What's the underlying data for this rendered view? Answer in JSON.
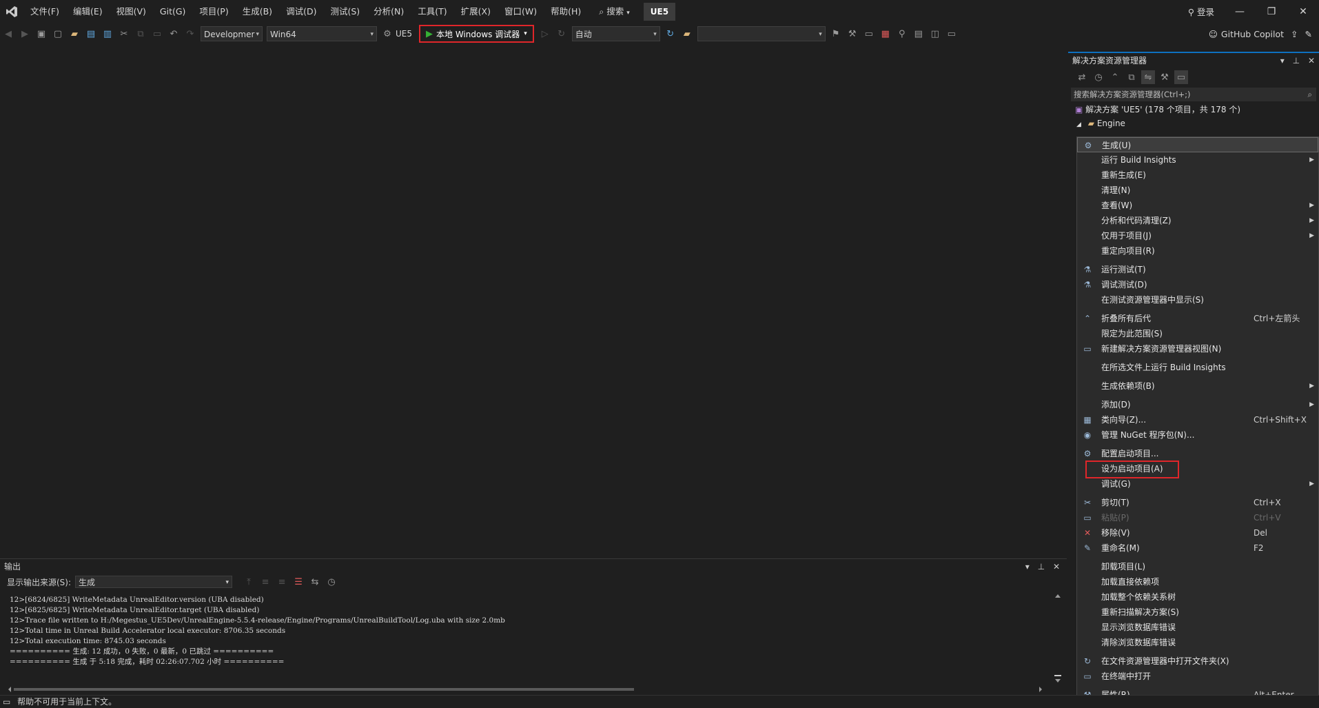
{
  "menubar": {
    "items": [
      "文件(F)",
      "编辑(E)",
      "视图(V)",
      "Git(G)",
      "项目(P)",
      "生成(B)",
      "调试(D)",
      "测试(S)",
      "分析(N)",
      "工具(T)",
      "扩展(X)",
      "窗口(W)",
      "帮助(H)"
    ],
    "search_label": "搜索",
    "solution_badge": "UE5",
    "login_label": "登录",
    "window_controls": [
      "—",
      "❐",
      "✕"
    ]
  },
  "toolbar": {
    "config": "Developmer",
    "platform": "Win64",
    "startup_project": "UE5",
    "run_label": "本地 Windows 调试器",
    "auto_label": "自动",
    "copilot_label": "GitHub Copilot",
    "highlight_color": "#e0262a"
  },
  "solution_explorer": {
    "title": "解决方案资源管理器",
    "search_placeholder": "搜索解决方案资源管理器(Ctrl+;)",
    "solution_node": "解决方案 'UE5' (178 个项目，共 178 个)",
    "engine_node": "Engine",
    "accent_color": "#0e70c0"
  },
  "context_menu": {
    "groups": [
      [
        {
          "icon": "build-icon",
          "label": "生成(U)",
          "highlight": true
        },
        {
          "label": "运行 Build Insights",
          "submenu": true
        },
        {
          "label": "重新生成(E)"
        },
        {
          "label": "清理(N)"
        },
        {
          "label": "查看(W)",
          "submenu": true
        },
        {
          "label": "分析和代码清理(Z)",
          "submenu": true
        },
        {
          "label": "仅用于项目(J)",
          "submenu": true
        },
        {
          "label": "重定向项目(R)"
        }
      ],
      [
        {
          "icon": "run-test-icon",
          "label": "运行测试(T)"
        },
        {
          "icon": "debug-test-icon",
          "label": "调试测试(D)"
        },
        {
          "label": "在测试资源管理器中显示(S)"
        }
      ],
      [
        {
          "icon": "collapse-icon",
          "label": "折叠所有后代",
          "shortcut": "Ctrl+左箭头"
        },
        {
          "label": "限定为此范围(S)"
        },
        {
          "icon": "new-view-icon",
          "label": "新建解决方案资源管理器视图(N)"
        }
      ],
      [
        {
          "label": "在所选文件上运行 Build Insights"
        }
      ],
      [
        {
          "label": "生成依赖项(B)",
          "submenu": true
        }
      ],
      [
        {
          "label": "添加(D)",
          "submenu": true
        },
        {
          "icon": "class-wizard-icon",
          "label": "类向导(Z)...",
          "shortcut": "Ctrl+Shift+X"
        },
        {
          "icon": "nuget-icon",
          "label": "管理 NuGet 程序包(N)..."
        }
      ],
      [
        {
          "icon": "gear-icon",
          "label": "配置启动项目..."
        },
        {
          "label": "设为启动项目(A)",
          "boxed": true
        },
        {
          "label": "调试(G)",
          "submenu": true
        }
      ],
      [
        {
          "icon": "cut-icon",
          "label": "剪切(T)",
          "shortcut": "Ctrl+X"
        },
        {
          "icon": "paste-icon",
          "label": "粘贴(P)",
          "shortcut": "Ctrl+V",
          "disabled": true
        },
        {
          "icon": "remove-icon",
          "label": "移除(V)",
          "shortcut": "Del"
        },
        {
          "icon": "rename-icon",
          "label": "重命名(M)",
          "shortcut": "F2"
        }
      ],
      [
        {
          "label": "卸载项目(L)"
        },
        {
          "label": "加载直接依赖项"
        },
        {
          "label": "加载整个依赖关系树"
        },
        {
          "label": "重新扫描解决方案(S)"
        },
        {
          "label": "显示浏览数据库错误"
        },
        {
          "label": "清除浏览数据库错误"
        }
      ],
      [
        {
          "icon": "open-folder-icon",
          "label": "在文件资源管理器中打开文件夹(X)"
        },
        {
          "icon": "terminal-icon",
          "label": "在终端中打开"
        }
      ],
      [
        {
          "icon": "wrench-icon",
          "label": "属性(R)",
          "shortcut": "Alt+Enter"
        }
      ]
    ]
  },
  "output": {
    "title": "输出",
    "source_label": "显示输出来源(S):",
    "source_value": "生成",
    "lines": [
      "12>[6824/6825] WriteMetadata UnrealEditor.version (UBA disabled)",
      "12>[6825/6825] WriteMetadata UnrealEditor.target (UBA disabled)",
      "12>Trace file written to H:/Megestus_UE5Dev/UnrealEngine-5.5.4-release/Engine/Programs/UnrealBuildTool/Log.uba with size 2.0mb",
      "12>Total time in Unreal Build Accelerator local executor: 8706.35 seconds",
      "12>Total execution time: 8745.03 seconds",
      "========== 生成: 12 成功，0 失败，0 最新，0 已跳过 ==========",
      "========== 生成 于 5:18 完成，耗时 02:26:07.702 小时 =========="
    ]
  },
  "status": {
    "message": "帮助不可用于当前上下文。"
  }
}
